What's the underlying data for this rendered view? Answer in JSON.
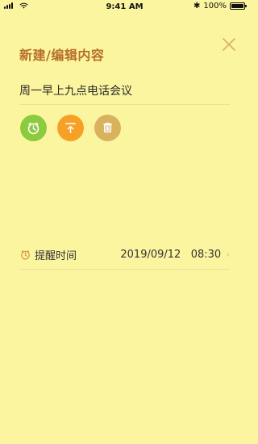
{
  "status_bar": {
    "time": "9:41 AM",
    "battery_text": "100%",
    "bluetooth_icon": "bluetooth-icon",
    "battery_icon": "battery-icon"
  },
  "header": {
    "title": "新建/编辑内容",
    "close_icon": "close-icon"
  },
  "note": {
    "content": "周一早上九点电话会议"
  },
  "actions": [
    {
      "name": "alarm-button",
      "icon": "alarm-clock-icon",
      "color": "#8BCB3D"
    },
    {
      "name": "pin-top-button",
      "icon": "pin-top-icon",
      "color": "#F6A126"
    },
    {
      "name": "delete-button",
      "icon": "trash-icon",
      "color": "#D9B25E"
    }
  ],
  "reminder": {
    "label": "提醒时间",
    "value": "2019/09/12   08:30",
    "icon": "alarm-clock-icon",
    "chevron_icon": "chevron-right-icon"
  },
  "colors": {
    "background": "#FCF59F",
    "title": "#B5702B",
    "divider": "#E9E19B",
    "text": "#333333"
  }
}
